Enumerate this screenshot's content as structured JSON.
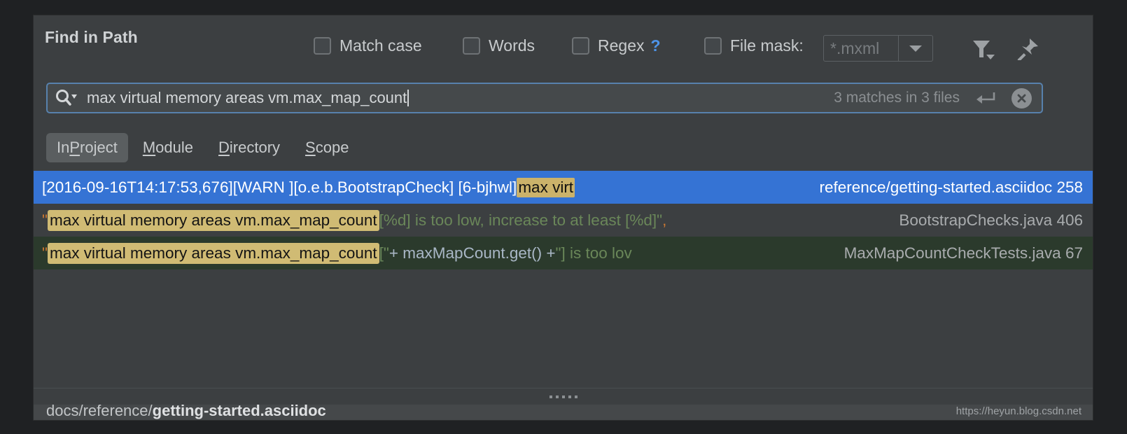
{
  "dialog": {
    "title": "Find in Path"
  },
  "options": {
    "match_case": {
      "label": "Match case",
      "checked": false
    },
    "words": {
      "label": "Words",
      "checked": false
    },
    "regex": {
      "label": "Regex",
      "checked": false,
      "help": "?"
    },
    "file_mask": {
      "label": "File mask:",
      "checked": false,
      "value": "*.mxml"
    }
  },
  "toolbar": {
    "filter_icon": "filter-icon",
    "pin_icon": "pin-icon"
  },
  "search": {
    "icon": "search-icon",
    "value": "max virtual memory areas vm.max_map_count",
    "status": "3 matches in 3 files",
    "enter_icon": "enter-arrow-icon",
    "clear_icon": "clear-circle-icon"
  },
  "scope_tabs": [
    {
      "pre": "In ",
      "mnemonic": "P",
      "post": "roject",
      "active": true
    },
    {
      "pre": "",
      "mnemonic": "M",
      "post": "odule",
      "active": false
    },
    {
      "pre": "",
      "mnemonic": "D",
      "post": "irectory",
      "active": false
    },
    {
      "pre": "",
      "mnemonic": "S",
      "post": "cope",
      "active": false
    }
  ],
  "results": [
    {
      "selected": true,
      "prefix": "[2016-09-16T14:17:53,676][WARN ][o.e.b.BootstrapCheck",
      "gap": "     ",
      "middle": "] [6-bjhwl] ",
      "highlight": "max virt",
      "suffix": "",
      "file": "reference/getting-started.asciidoc",
      "line": "258"
    },
    {
      "selected": false,
      "quote": "\"",
      "highlight": "max virtual memory areas vm.max_map_count",
      "tail_string": " [%d] is too low, increase to at least [%d]\"",
      "tail_punct": ",",
      "file": "BootstrapChecks.java",
      "line": "406"
    },
    {
      "selected": false,
      "quote": "\"",
      "highlight": "max virtual memory areas vm.max_map_count",
      "tail_a": " [\" ",
      "tail_code": "+ maxMapCount.get() +",
      "tail_b": " \"] is too lov",
      "file": "MaxMapCountCheckTests.java",
      "line": "67"
    }
  ],
  "footer": {
    "path_prefix": "docs/reference/",
    "path_file": "getting-started.asciidoc"
  },
  "watermark": "https://heyun.blog.csdn.net",
  "colors": {
    "dialog_bg": "#3c3f41",
    "selection_blue": "#3573d4",
    "match_highlight": "#cbb26a",
    "row3_bg": "#2b3a2c",
    "string_green": "#6a8759",
    "punct_orange": "#cc7832",
    "accent_blue": "#4e94e8",
    "focus_border": "#5781ad"
  }
}
